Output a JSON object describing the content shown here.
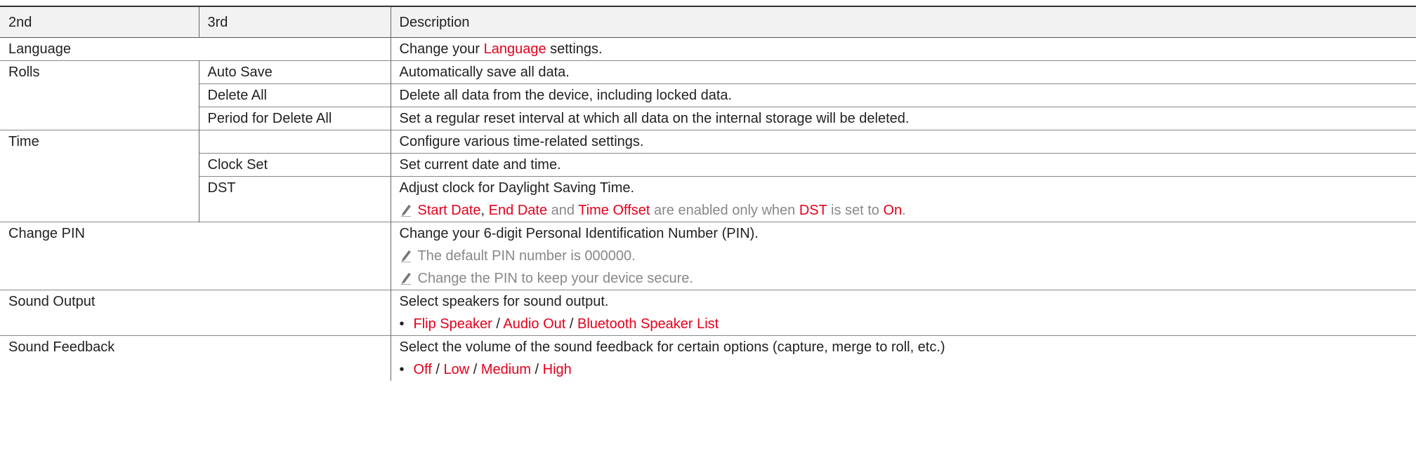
{
  "header": {
    "col1": "2nd",
    "col2": "3rd",
    "col3": "Description"
  },
  "rows": {
    "language": {
      "second": "Language",
      "desc_pre": "Change your ",
      "desc_red": "Language",
      "desc_post": " settings."
    },
    "rolls": {
      "second": "Rolls",
      "auto_save": {
        "third": "Auto Save",
        "desc": "Automatically save all data."
      },
      "delete_all": {
        "third": "Delete All",
        "desc": "Delete all data from the device, including locked data."
      },
      "period": {
        "third": "Period for Delete All",
        "desc": "Set a regular reset interval at which all data on the internal storage will be deleted."
      }
    },
    "time": {
      "second": "Time",
      "desc": "Configure various time-related settings.",
      "clock_set": {
        "third": "Clock Set",
        "desc": "Set current date and time."
      },
      "dst": {
        "third": "DST",
        "desc": "Adjust clock for Daylight Saving Time.",
        "note": {
          "a": "Start Date",
          "s1": ", ",
          "b": "End Date",
          "s2": " and ",
          "c": "Time Offset",
          "s3": " are enabled only when ",
          "d": "DST",
          "s4": " is set to ",
          "e": "On",
          "s5": "."
        }
      }
    },
    "change_pin": {
      "second": "Change PIN",
      "desc": "Change your 6-digit Personal Identification Number (PIN).",
      "note1": "The default PIN number is 000000.",
      "note2": "Change the PIN to keep your device secure."
    },
    "sound_output": {
      "second": "Sound Output",
      "desc": "Select speakers for sound output.",
      "bullet": "•",
      "opt1": "Flip Speaker",
      "sep": " / ",
      "opt2": "Audio Out",
      "opt3": "Bluetooth Speaker List"
    },
    "sound_feedback": {
      "second": "Sound Feedback",
      "desc": "Select the volume of the sound feedback for certain options (capture, merge to roll, etc.)",
      "bullet": "•",
      "opt1": "Off",
      "sep": " / ",
      "opt2": "Low",
      "opt3": "Medium",
      "opt4": "High"
    }
  },
  "colors": {
    "accent": "#e4001b",
    "note_gray": "#888888",
    "header_bg": "#f2f2f2"
  },
  "icons": {
    "note": "pencil-icon"
  }
}
